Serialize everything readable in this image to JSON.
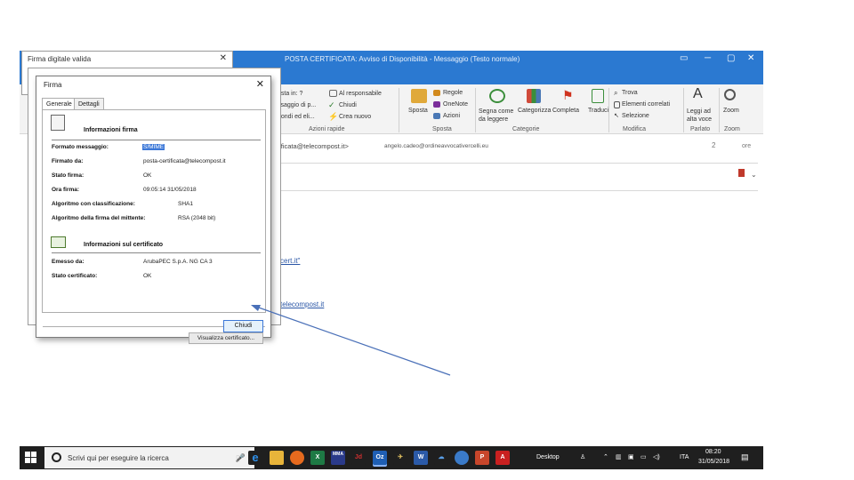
{
  "outlook": {
    "title": "POSTA CERTIFICATA: Avviso di Disponibilità  -  Messaggio (Testo normale)",
    "ribbon": {
      "respond_items": [
        "osta in: ?",
        "ssaggio di p...",
        "pondi ed eli..."
      ],
      "quick_items": [
        "Al responsabile",
        "Chiudi",
        "Crea nuovo"
      ],
      "quick_group": "Azioni rapide",
      "move_button": "Sposta",
      "rules": "Regole",
      "onenote": "OneNote",
      "actions": "Azioni",
      "move_group": "Sposta",
      "tag_buttons": [
        "Segna come da leggere",
        "Categorizza",
        "Completa",
        "Traduci"
      ],
      "tag_group": "Categorie",
      "edit_items": [
        "Trova",
        "Elementi correlati",
        "Selezione"
      ],
      "edit_group": "Modifica",
      "read_aloud": "Leggi ad alta voce",
      "speech_group": "Parlato",
      "zoom": "Zoom",
      "zoom_group": "Zoom"
    },
    "from_line": "tificata@telecompost.it>",
    "to_line": "angelo.cadeo@ordineavvocativercelli.eu",
    "count": "2",
    "count_tail": "ore",
    "link1": "cert.it\"",
    "link2": "telecompost.it"
  },
  "back_dialog": {
    "title": "Firma digitale valida"
  },
  "dialog": {
    "title": "Firma",
    "tabs": [
      "Generale",
      "Dettagli"
    ],
    "signature_section": "Informazioni firma",
    "fields": [
      {
        "label": "Formato messaggio:",
        "value": "S/MIME"
      },
      {
        "label": "Firmato da:",
        "value": "posta-certificata@telecompost.it"
      },
      {
        "label": "Stato firma:",
        "value": "OK"
      },
      {
        "label": "Ora firma:",
        "value": "09:05:14 31/05/2018"
      },
      {
        "label": "Algoritmo con classificazione:",
        "value": "SHA1"
      },
      {
        "label": "Algoritmo della firma del mittente:",
        "value": "RSA (2048 bit)"
      }
    ],
    "cert_section": "Informazioni sul certificato",
    "cert_fields": [
      {
        "label": "Emesso da:",
        "value": "ArubaPEC S.p.A. NG CA 3"
      },
      {
        "label": "Stato certificato:",
        "value": "OK"
      }
    ],
    "view_cert_button": "Visualizza certificato...",
    "close_button": "Chiudi"
  },
  "taskbar": {
    "search_placeholder": "Scrivi qui per eseguire la ricerca",
    "apps": [
      "Edge",
      "Esplora file",
      "Firefox",
      "Excel",
      "MMA",
      "Acrobat",
      "Outlook",
      "Word",
      "OneDrive",
      "Chrome",
      "PowerPoint",
      "Acrobat Reader"
    ],
    "desktop_label": "Desktop",
    "language": "ITA",
    "time": "08:20",
    "date": "31/05/2018"
  }
}
